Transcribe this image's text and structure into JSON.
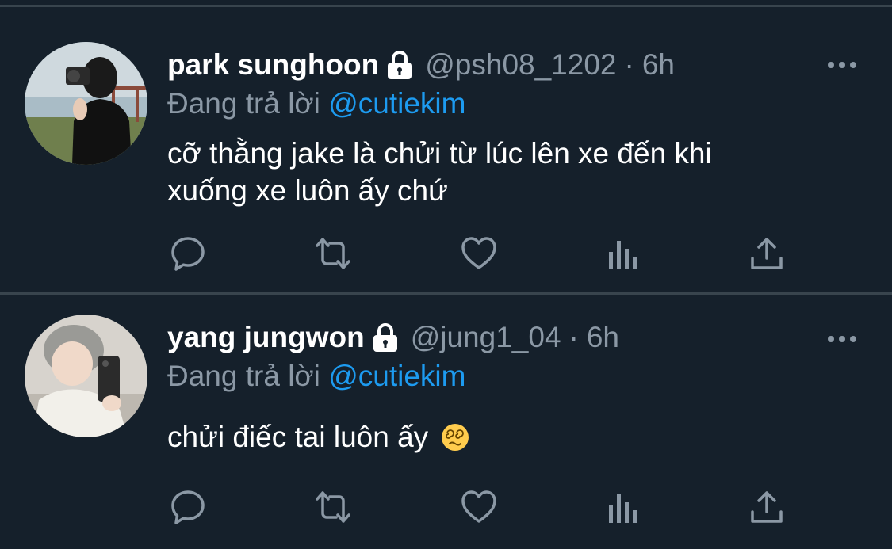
{
  "tweets": [
    {
      "display_name": "park sunghoon",
      "handle": "@psh08_1202",
      "separator": "·",
      "time": "6h",
      "replying_prefix": "Đang trả lời",
      "replying_to": "@cutiekim",
      "text_line1": "cỡ thằng jake là chửi từ lúc lên xe đến khi",
      "text_line2": "xuống xe luôn ấy chứ",
      "avatar": "profile-photo-camera"
    },
    {
      "display_name": "yang jungwon",
      "handle": "@jung1_04",
      "separator": "·",
      "time": "6h",
      "replying_prefix": "Đang trả lời",
      "replying_to": "@cutiekim",
      "text_line1": "chửi điếc tai luôn ấy",
      "emoji": "dizzy-face-emoji",
      "avatar": "profile-photo-selfie"
    }
  ],
  "icons": {
    "lock": "lock-icon",
    "more": "more-horizontal-icon",
    "reply": "reply-icon",
    "retweet": "retweet-icon",
    "like": "like-icon",
    "analytics": "analytics-icon",
    "share": "share-icon"
  },
  "colors": {
    "background": "#15202b",
    "divider": "#38444d",
    "secondary_text": "#8b98a5",
    "accent": "#1d9bf0",
    "primary_text": "#ffffff"
  }
}
